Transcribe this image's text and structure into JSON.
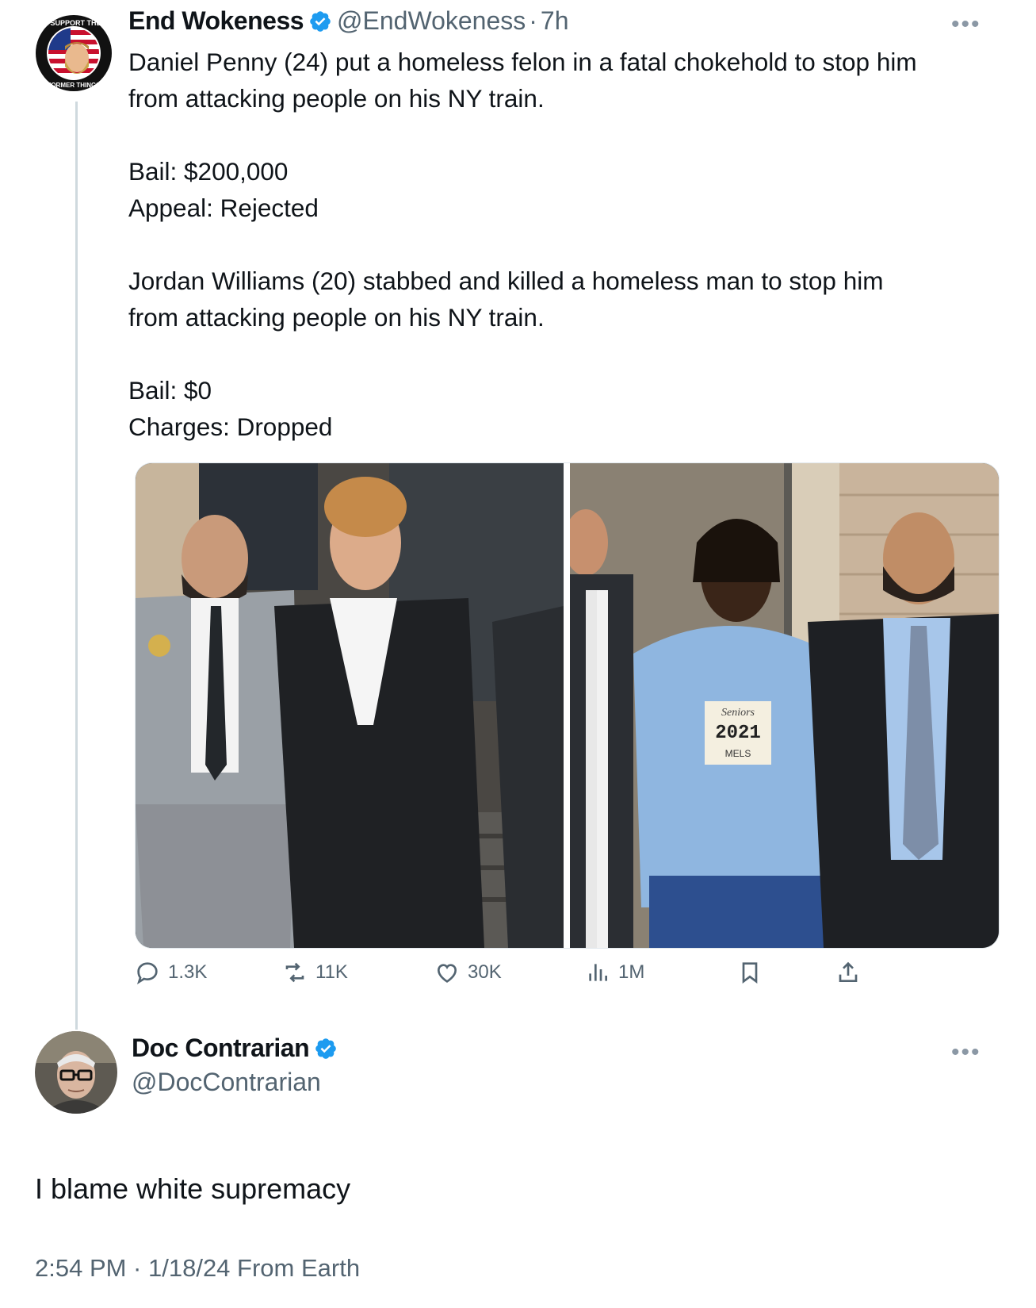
{
  "original_tweet": {
    "avatar_icon": "support-the-former-things-badge-icon",
    "display_name": "End Wokeness",
    "handle": "@EndWokeness",
    "separator": "·",
    "time_ago": "7h",
    "more_icon": "ellipsis-icon",
    "text": "Daniel Penny (24) put a homeless felon in a fatal chokehold to stop him\nfrom attacking people on his NY train.\n\nBail: $200,000\nAppeal: Rejected\n\nJordan Williams (20) stabbed and killed a homeless man to stop him\nfrom attacking people on his NY train.\n\nBail: $0\nCharges: Dropped",
    "media": {
      "left_photo": "photo-suited-man-escorted-by-detective",
      "right_photo": "photo-man-in-blue-hoodie-escorted-by-detective",
      "hoodie_print_1": "Seniors",
      "hoodie_print_2": "2021",
      "hoodie_print_3": "MELS"
    },
    "actions": {
      "replies": "1.3K",
      "reposts": "11K",
      "likes": "30K",
      "views": "1M"
    }
  },
  "reply_tweet": {
    "avatar_icon": "elderly-man-with-glasses-avatar",
    "display_name": "Doc Contrarian",
    "handle": "@DocContrarian",
    "more_icon": "ellipsis-icon",
    "text": "I blame white supremacy",
    "timestamp": "2:54 PM · 1/18/24 From Earth"
  },
  "colors": {
    "verified_blue": "#1d9bf0",
    "secondary_text": "#536471",
    "thread_line": "#cfd9de",
    "hoodie_blue": "#8fb6e0"
  }
}
